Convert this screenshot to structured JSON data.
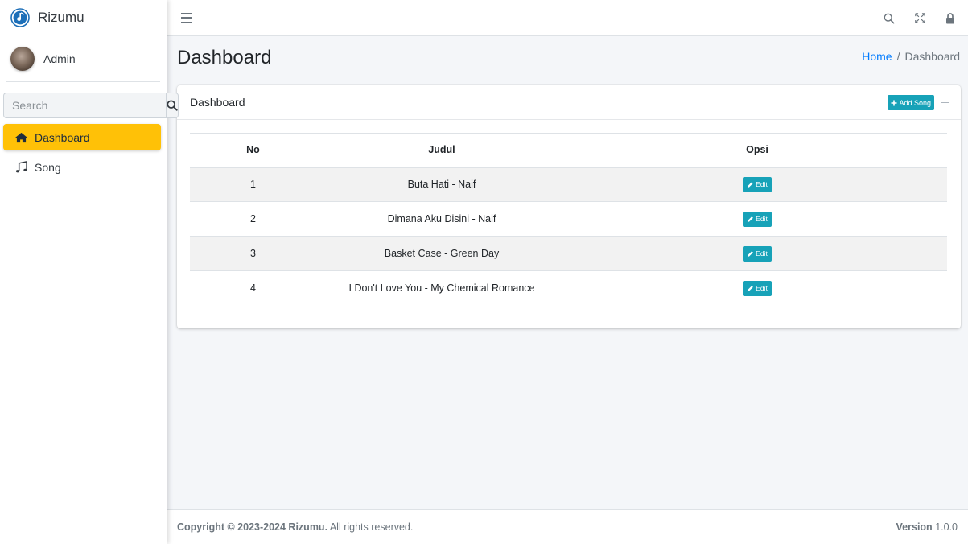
{
  "brand": {
    "name": "Rizumu"
  },
  "user": {
    "name": "Admin"
  },
  "search": {
    "placeholder": "Search"
  },
  "sidebar": {
    "items": [
      {
        "label": "Dashboard",
        "icon": "home-icon",
        "active": true
      },
      {
        "label": "Song",
        "icon": "music-icon",
        "active": false
      }
    ]
  },
  "topbar": {
    "icons": [
      "search-icon",
      "fullscreen-icon",
      "lock-icon"
    ]
  },
  "page": {
    "title": "Dashboard"
  },
  "breadcrumb": {
    "home": "Home",
    "separator": "/",
    "current": "Dashboard"
  },
  "card": {
    "title": "Dashboard",
    "add_label": "Add Song",
    "table": {
      "headers": [
        "No",
        "Judul",
        "Opsi"
      ],
      "rows": [
        {
          "no": "1",
          "judul": "Buta Hati - Naif",
          "action": "Edit"
        },
        {
          "no": "2",
          "judul": "Dimana Aku Disini - Naif",
          "action": "Edit"
        },
        {
          "no": "3",
          "judul": "Basket Case - Green Day",
          "action": "Edit"
        },
        {
          "no": "4",
          "judul": "I Don't Love You - My Chemical Romance",
          "action": "Edit"
        }
      ]
    }
  },
  "footer": {
    "copyright_bold": "Copyright © 2023-2024 Rizumu.",
    "copyright_rest": "All rights reserved.",
    "version_label": "Version",
    "version_value": "1.0.0"
  },
  "colors": {
    "accent": "#ffc107",
    "info": "#17a2b8",
    "link": "#007bff"
  }
}
